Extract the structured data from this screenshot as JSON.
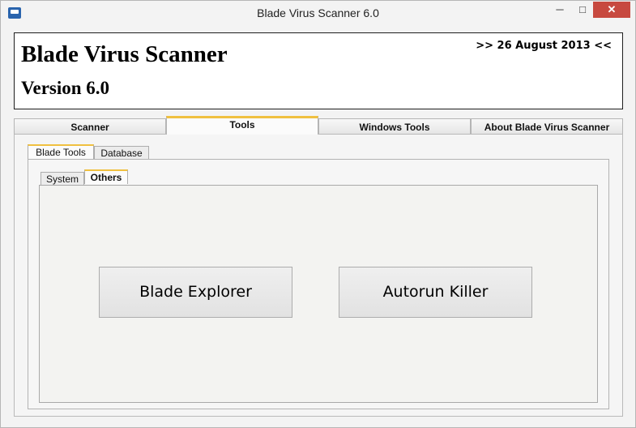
{
  "window": {
    "title": "Blade Virus Scanner 6.0",
    "controls": {
      "minimize": "─",
      "maximize": "□",
      "close": "✕"
    }
  },
  "header": {
    "title": "Blade Virus Scanner",
    "version": "Version 6.0",
    "date": ">> 26 August 2013 <<"
  },
  "main_tabs": [
    {
      "label": "Scanner",
      "active": false
    },
    {
      "label": "Tools",
      "active": true
    },
    {
      "label": "Windows Tools",
      "active": false
    },
    {
      "label": "About Blade Virus Scanner",
      "active": false
    }
  ],
  "tools_tabs": [
    {
      "label": "Blade Tools",
      "active": true
    },
    {
      "label": "Database",
      "active": false
    }
  ],
  "blade_tools_tabs": [
    {
      "label": "System",
      "active": false
    },
    {
      "label": "Others",
      "active": true
    }
  ],
  "buttons": {
    "explorer": "Blade Explorer",
    "autorun": "Autorun Killer"
  },
  "colors": {
    "active_tab_accent": "#f0c040",
    "close_button": "#c7493f"
  }
}
